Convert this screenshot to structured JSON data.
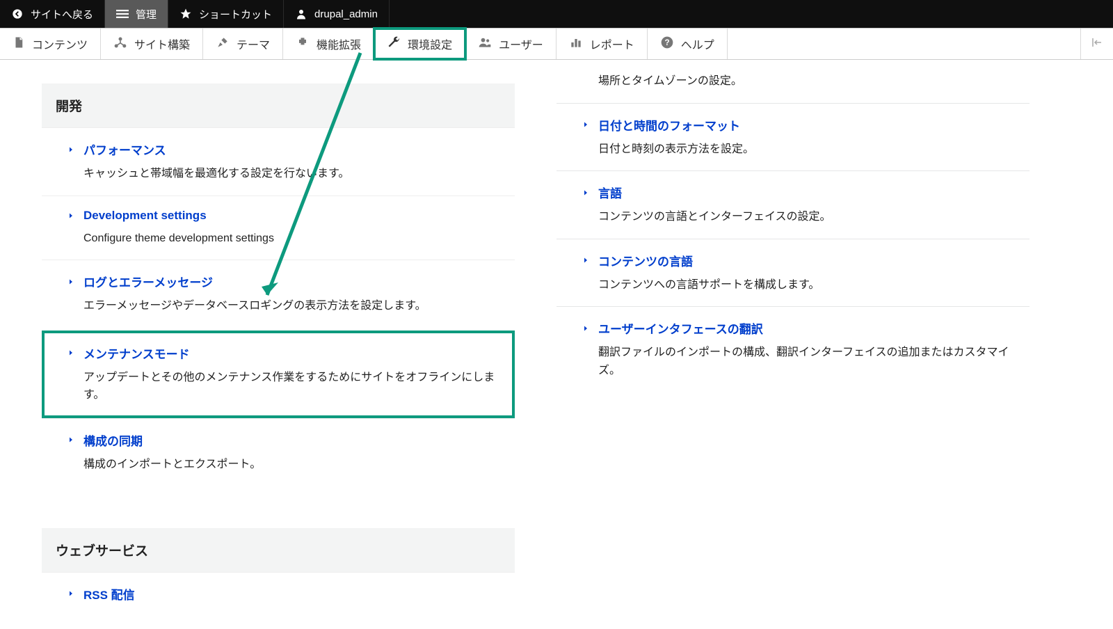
{
  "toolbar": {
    "back": "サイトへ戻る",
    "manage": "管理",
    "shortcuts": "ショートカット",
    "user": "drupal_admin"
  },
  "menu": {
    "content": "コンテンツ",
    "structure": "サイト構築",
    "appearance": "テーマ",
    "extend": "機能拡張",
    "configuration": "環境設定",
    "people": "ユーザー",
    "reports": "レポート",
    "help": "ヘルプ"
  },
  "left": {
    "section1_title": "開発",
    "items1": [
      {
        "label": "パフォーマンス",
        "desc": "キャッシュと帯域幅を最適化する設定を行ないます。"
      },
      {
        "label": "Development settings",
        "desc": "Configure theme development settings"
      },
      {
        "label": "ログとエラーメッセージ",
        "desc": "エラーメッセージやデータベースロギングの表示方法を設定します。"
      },
      {
        "label": "メンテナンスモード",
        "desc": "アップデートとその他のメンテナンス作業をするためにサイトをオフラインにします。"
      },
      {
        "label": "構成の同期",
        "desc": "構成のインポートとエクスポート。"
      }
    ],
    "section2_title": "ウェブサービス",
    "items2": [
      {
        "label": "RSS 配信",
        "desc": ""
      }
    ]
  },
  "right": {
    "partial_item_desc": "場所とタイムゾーンの設定。",
    "items": [
      {
        "label": "日付と時間のフォーマット",
        "desc": "日付と時刻の表示方法を設定。"
      },
      {
        "label": "言語",
        "desc": "コンテンツの言語とインターフェイスの設定。"
      },
      {
        "label": "コンテンツの言語",
        "desc": "コンテンツへの言語サポートを構成します。"
      },
      {
        "label": "ユーザーインタフェースの翻訳",
        "desc": "翻訳ファイルのインポートの構成、翻訳インターフェイスの追加またはカスタマイズ。"
      }
    ]
  }
}
